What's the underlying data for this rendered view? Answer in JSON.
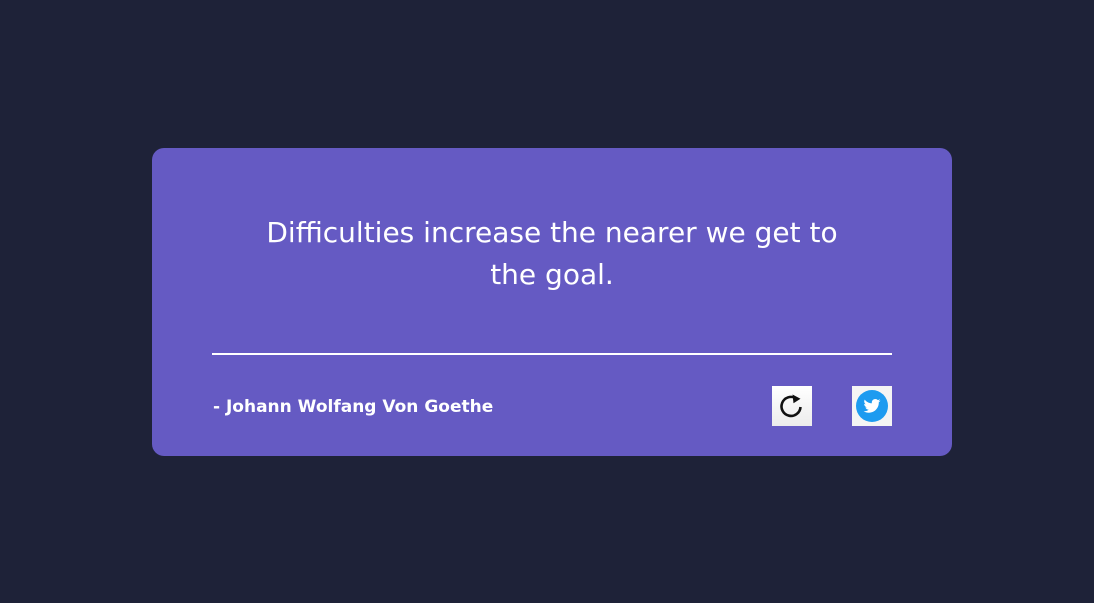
{
  "quote": {
    "text": "Difficulties increase the nearer we get to the goal.",
    "author": "- Johann Wolfang Von Goethe"
  },
  "actions": {
    "refresh": {
      "icon": "refresh-icon"
    },
    "tweet": {
      "icon": "twitter-icon"
    }
  },
  "colors": {
    "background": "#1e2238",
    "card": "#655ac3",
    "text": "#ffffff",
    "twitter": "#1d9bf0"
  }
}
